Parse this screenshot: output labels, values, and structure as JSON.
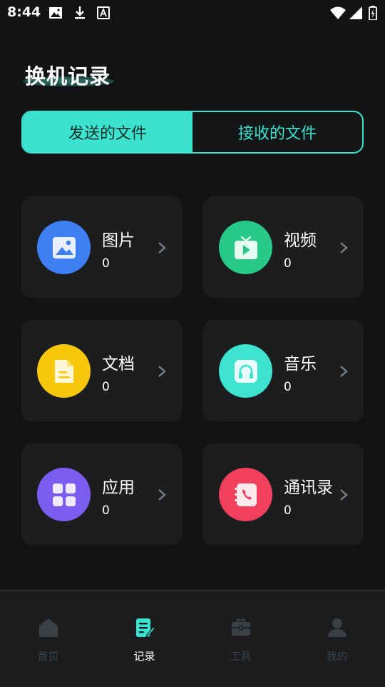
{
  "status_bar": {
    "time": "8:44",
    "left_icons": [
      "image-icon",
      "download-icon",
      "font-icon"
    ],
    "right_icons": [
      "wifi-icon",
      "signal-icon",
      "battery-icon"
    ]
  },
  "page": {
    "title": "换机记录"
  },
  "tabs": [
    {
      "label": "发送的文件",
      "active": true
    },
    {
      "label": "接收的文件",
      "active": false
    }
  ],
  "categories": [
    {
      "label": "图片",
      "count": "0",
      "icon": "image-icon",
      "color": "#3e7ff4"
    },
    {
      "label": "视频",
      "count": "0",
      "icon": "tv-play-icon",
      "color": "#27c986"
    },
    {
      "label": "文档",
      "count": "0",
      "icon": "document-icon",
      "color": "#f9c80a"
    },
    {
      "label": "音乐",
      "count": "0",
      "icon": "headphones-icon",
      "color": "#3ee3cf"
    },
    {
      "label": "应用",
      "count": "0",
      "icon": "apps-grid-icon",
      "color": "#7a5cf0"
    },
    {
      "label": "通讯录",
      "count": "0",
      "icon": "contacts-book-icon",
      "color": "#f0405e"
    }
  ],
  "bottom_nav": [
    {
      "label": "首页",
      "icon": "home-icon",
      "active": false
    },
    {
      "label": "记录",
      "icon": "record-icon",
      "active": true
    },
    {
      "label": "工具",
      "icon": "toolbox-icon",
      "active": false
    },
    {
      "label": "我的",
      "icon": "user-icon",
      "active": false
    }
  ],
  "colors": {
    "accent": "#3be3cf",
    "background": "#121314",
    "card": "#1b1d1f",
    "nav_inactive": "#3c4045"
  }
}
